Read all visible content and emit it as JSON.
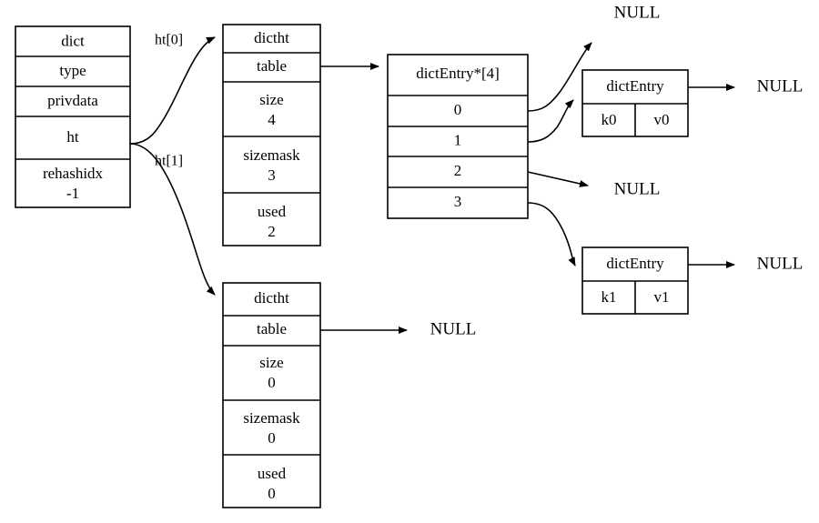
{
  "diagram": {
    "title": "redis dict / dictht / dictEntry structure",
    "colors": {
      "stroke": "#000000",
      "fill": "#ffffff",
      "text": "#000000"
    },
    "dict_struct": {
      "name": "dict",
      "fields": [
        {
          "label": "dict",
          "value": ""
        },
        {
          "label": "type",
          "value": ""
        },
        {
          "label": "privdata",
          "value": ""
        },
        {
          "label": "ht",
          "value": ""
        },
        {
          "label": "rehashidx",
          "value": "-1"
        }
      ]
    },
    "dictht0": {
      "name": "dictht",
      "fields": [
        {
          "label": "dictht",
          "value": ""
        },
        {
          "label": "table",
          "value": ""
        },
        {
          "label": "size",
          "value": "4"
        },
        {
          "label": "sizemask",
          "value": "3"
        },
        {
          "label": "used",
          "value": "2"
        }
      ]
    },
    "dictht1": {
      "name": "dictht",
      "fields": [
        {
          "label": "dictht",
          "value": ""
        },
        {
          "label": "table",
          "value": ""
        },
        {
          "label": "size",
          "value": "0"
        },
        {
          "label": "sizemask",
          "value": "0"
        },
        {
          "label": "used",
          "value": "0"
        }
      ]
    },
    "bucket_array": {
      "header": "dictEntry*[4]",
      "slots": [
        "0",
        "1",
        "2",
        "3"
      ]
    },
    "entry0": {
      "header": "dictEntry",
      "key": "k0",
      "value": "v0"
    },
    "entry1": {
      "header": "dictEntry",
      "key": "k1",
      "value": "v1"
    },
    "edge_labels": {
      "ht0": "ht[0]",
      "ht1": "ht[1]"
    },
    "null_labels": {
      "bucket0_null": "NULL",
      "bucket2_null": "NULL",
      "entry0_next_null": "NULL",
      "entry1_next_null": "NULL",
      "dictht1_table_null": "NULL"
    }
  }
}
